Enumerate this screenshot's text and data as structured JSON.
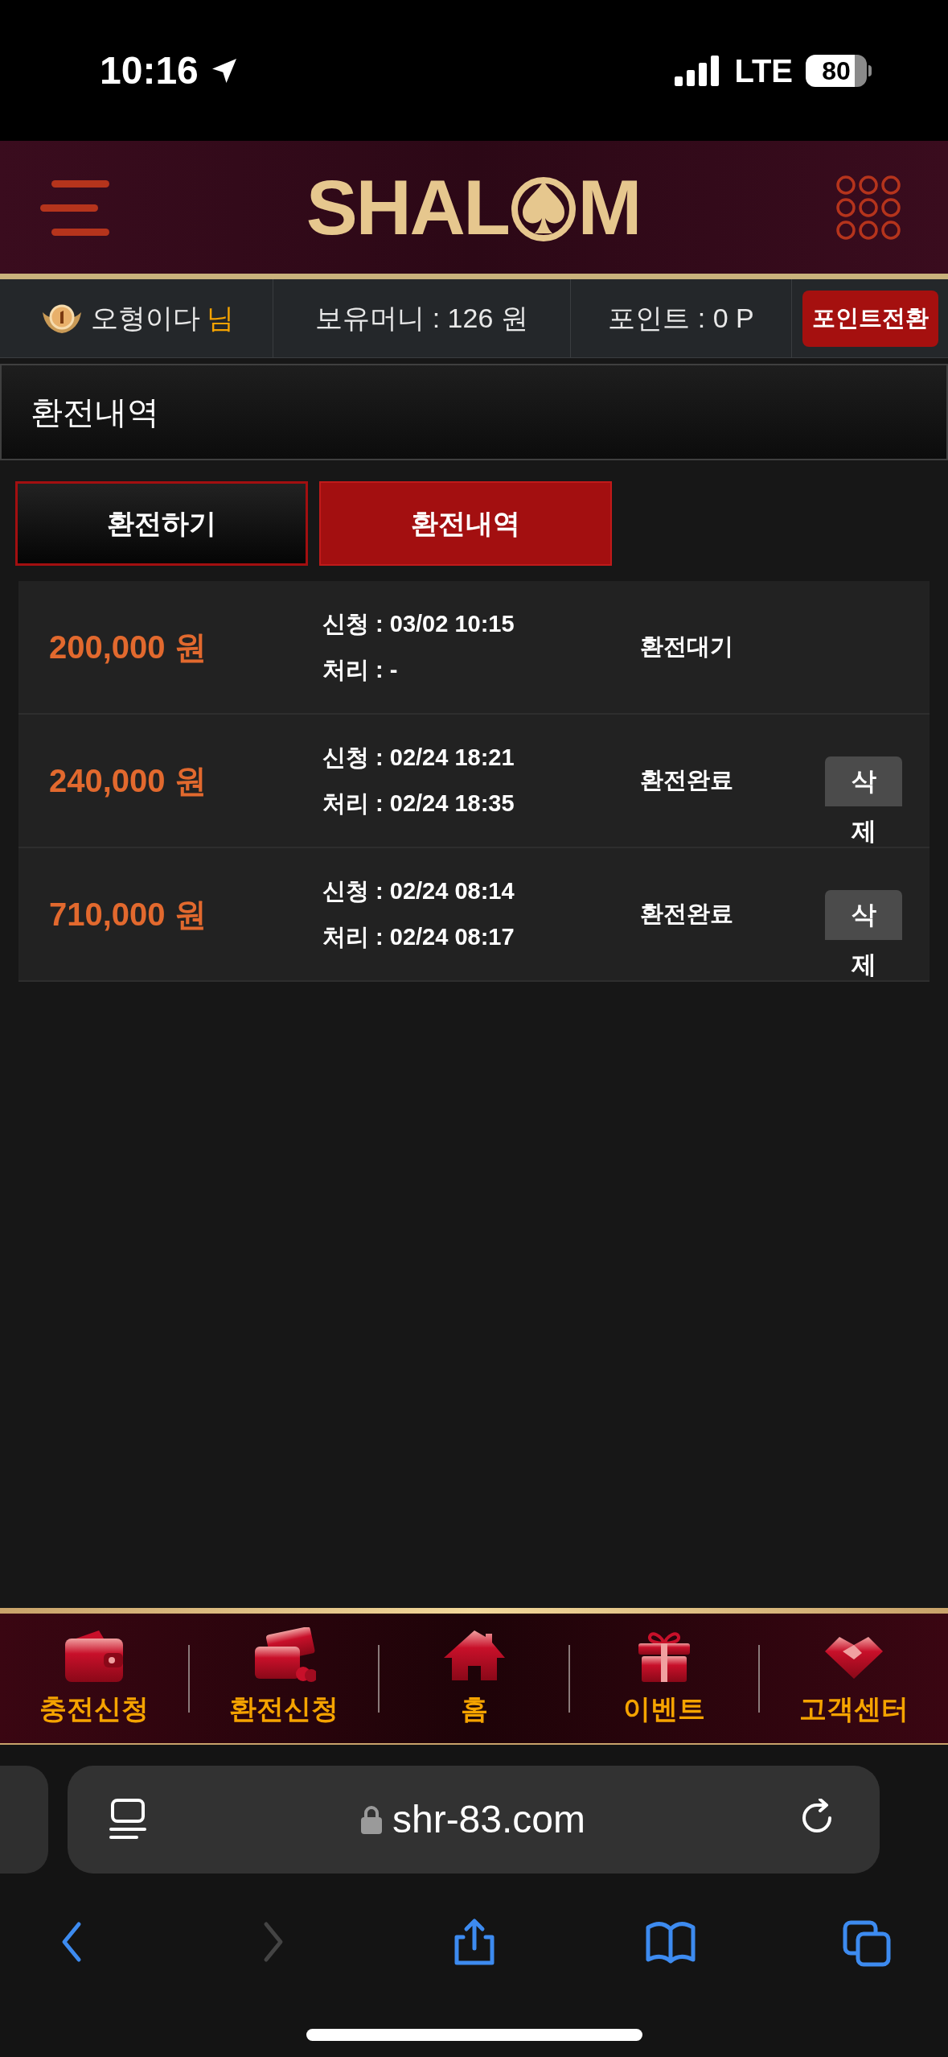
{
  "status_bar": {
    "time": "10:16",
    "network": "LTE",
    "battery": "80"
  },
  "header": {
    "logo_before": "SHAL",
    "logo_after": "M"
  },
  "user_bar": {
    "name": "오형이다",
    "honorific": "님",
    "balance": "보유머니 : 126 원",
    "points": "포인트 : 0 P",
    "convert_button": "포인트전환"
  },
  "page_title": "환전내역",
  "tabs": [
    {
      "label": "환전하기",
      "selected": false
    },
    {
      "label": "환전내역",
      "selected": true
    }
  ],
  "records": [
    {
      "amount": "200,000 원",
      "requested": "신청 : 03/02 10:15",
      "processed": "처리 : -",
      "status": "환전대기"
    },
    {
      "amount": "240,000 원",
      "requested": "신청 : 02/24 18:21",
      "processed": "처리 : 02/24 18:35",
      "status": "환전완료",
      "delete_button": "삭제"
    },
    {
      "amount": "710,000 원",
      "requested": "신청 : 02/24 08:14",
      "processed": "처리 : 02/24 08:17",
      "status": "환전완료",
      "delete_button": "삭제"
    }
  ],
  "bottom_nav": [
    {
      "label": "충전신청",
      "kind": "wallet"
    },
    {
      "label": "환전신청",
      "kind": "exchange"
    },
    {
      "label": "홈",
      "kind": "home"
    },
    {
      "label": "이벤트",
      "kind": "gift"
    },
    {
      "label": "고객센터",
      "kind": "handshake"
    }
  ],
  "browser": {
    "url": "shr-83.com",
    "toolbar": [
      {
        "kind": "back",
        "disabled": false
      },
      {
        "kind": "forward",
        "disabled": true
      },
      {
        "kind": "share",
        "disabled": false
      },
      {
        "kind": "bookmarks",
        "disabled": false
      },
      {
        "kind": "tabs",
        "disabled": false
      }
    ]
  }
}
